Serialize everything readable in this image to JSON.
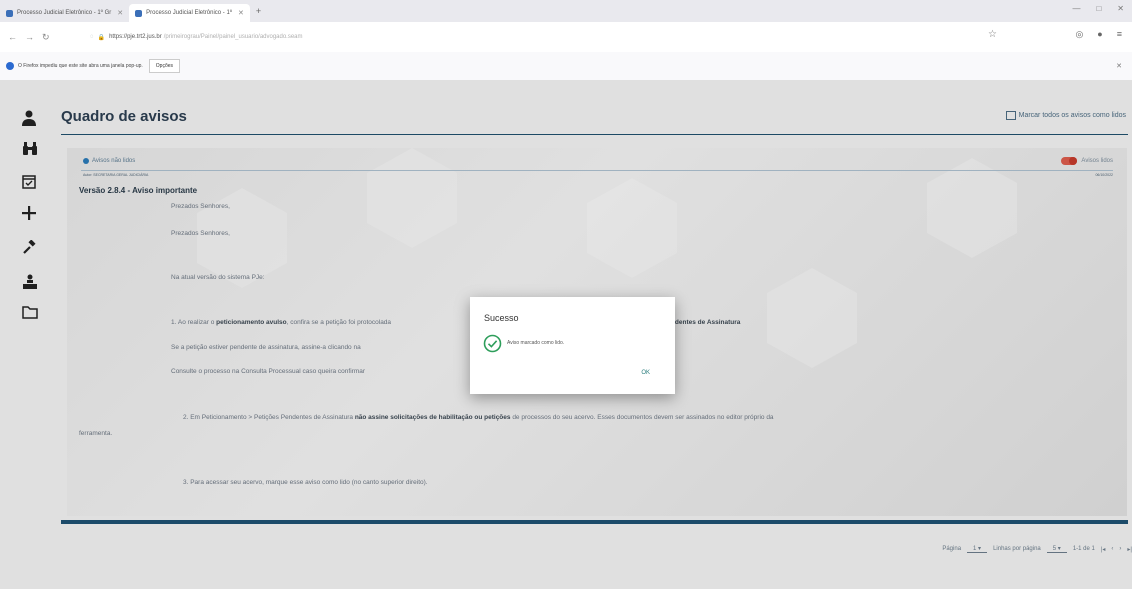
{
  "browser": {
    "tabs": [
      {
        "label": "Processo Judicial Eletrônico - 1º Gr",
        "active": false
      },
      {
        "label": "Processo Judicial Eletrônico - 1º",
        "active": true
      }
    ],
    "url_main": "https://pje.trt2.jus.br",
    "url_rest": "/primeirograu/Painel/painel_usuario/advogado.seam",
    "notification_text": "O Firefox impediu que este site abra uma janela pop-up.",
    "notification_button": "Opções"
  },
  "sidebar": {
    "icons": [
      "user-icon",
      "binoculars-icon",
      "calendar-check-icon",
      "plus-icon",
      "gavel-icon",
      "sitemap-icon",
      "folder-icon"
    ]
  },
  "page": {
    "title": "Quadro de avisos",
    "mark_all_label": "Marcar todos os avisos como lidos"
  },
  "notice": {
    "header": "Avisos não lidos",
    "toggle_label": "Avisos lidos",
    "meta_left": "Autor: SECRETARIA GERAL JUDICIÁRIA",
    "meta_right": "06/10/2022",
    "version_title": "Versão 2.8.4 - Aviso importante",
    "greeting_1": "Prezados Senhores,",
    "greeting_2": "Prezados Senhores,",
    "intro": "Na atual versão do sistema PJe:",
    "item1_pre": "1. Ao realizar o ",
    "item1_bold": "peticionamento avulso",
    "item1_post": ", confira se a petição foi protocolada",
    "item1_tail": "Pendentes de Assinatura",
    "item1_line2": "Se a petição estiver pendente de assinatura, assine-a clicando na",
    "item1_line3": "Consulte o processo na Consulta Processual caso queira confirmar",
    "item2_pre": "2. Em Peticionamento > Petições Pendentes de Assinatura ",
    "item2_bold1": "não assine solicitações de habilitação ou petições",
    "item2_post": " de processos do seu acervo. Esses documentos devem ser assinados no editor próprio da",
    "item2_cont": "ferramenta.",
    "item3": "3. Para acessar seu acervo, marque esse aviso como lido (no canto superior direito)."
  },
  "pagination": {
    "page_label": "Página",
    "page_value": "1",
    "per_page_label": "Linhas por página",
    "per_page_value": "5",
    "range": "1-1 de 1"
  },
  "dialog": {
    "title": "Sucesso",
    "message": "Aviso marcado como lido.",
    "ok_label": "OK",
    "success_color": "#2e9e5b"
  }
}
